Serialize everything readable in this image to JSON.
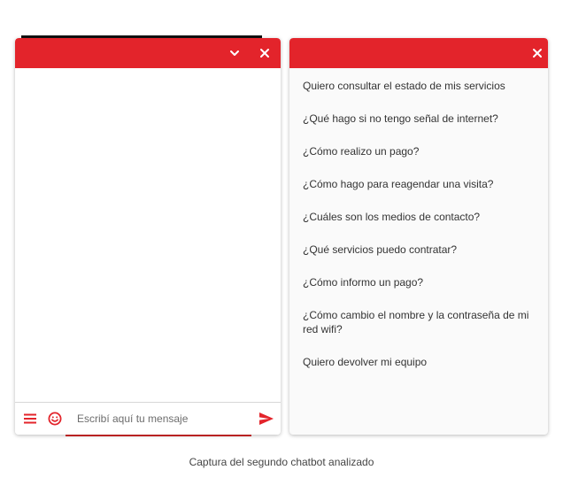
{
  "chat": {
    "input_placeholder": "Escribí aquí tu mensaje",
    "header_color": "#e3242b"
  },
  "faq": {
    "items": [
      "Quiero consultar el estado de mis servicios",
      "¿Qué hago si no tengo señal de internet?",
      "¿Cómo realizo un pago?",
      "¿Cómo hago para reagendar una visita?",
      "¿Cuáles son los medios de contacto?",
      "¿Qué servicios puedo contratar?",
      "¿Cómo informo un pago?",
      "¿Cómo cambio el nombre y la contraseña de mi red wifi?",
      "Quiero devolver mi equipo"
    ]
  },
  "caption": "Captura del segundo chatbot analizado",
  "icons": {
    "minimize": "chevron-down-icon",
    "close": "close-icon",
    "menu": "hamburger-menu-icon",
    "emoji": "smiley-icon",
    "send": "send-icon"
  },
  "colors": {
    "accent": "#e3242b",
    "panel_bg": "#fafafa",
    "text": "#333333"
  }
}
